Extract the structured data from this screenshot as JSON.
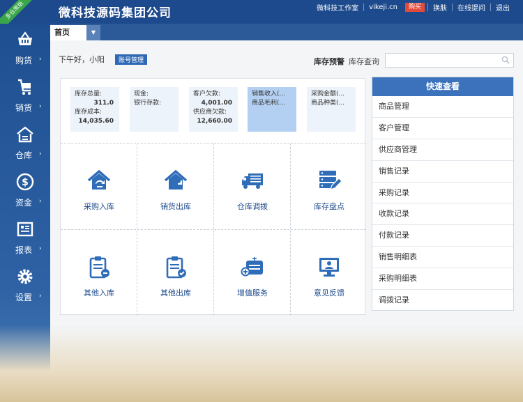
{
  "header": {
    "ribbon": "多仓库版",
    "company": "微科技源码集团公司",
    "links": [
      "微科技工作室",
      "vikeji.cn",
      "购买",
      "换肤",
      "在线提问",
      "退出"
    ]
  },
  "sidebar": {
    "items": [
      {
        "label": "购货",
        "icon": "basket-icon"
      },
      {
        "label": "销货",
        "icon": "cart-icon"
      },
      {
        "label": "仓库",
        "icon": "warehouse-icon"
      },
      {
        "label": "资金",
        "icon": "dollar-icon"
      },
      {
        "label": "报表",
        "icon": "report-icon"
      },
      {
        "label": "设置",
        "icon": "gear-icon"
      }
    ],
    "arrow": "›"
  },
  "tabs": {
    "home": "首页",
    "dropdown": "▼"
  },
  "top": {
    "greeting": "下午好，小阳",
    "account_btn": "账号管理",
    "stock_warn": "库存预警",
    "stock_query": "库存查询",
    "search_placeholder": ""
  },
  "stats": [
    {
      "lines": [
        {
          "k": "库存总量:",
          "v": "311.0"
        },
        {
          "k": "库存成本:",
          "v": "14,035.60"
        }
      ]
    },
    {
      "lines": [
        {
          "k": "现金:",
          "v": ""
        },
        {
          "k": "银行存款:",
          "v": ""
        }
      ]
    },
    {
      "lines": [
        {
          "k": "客户欠款:",
          "v": "4,001.00"
        },
        {
          "k": "供应商欠款:",
          "v": "12,660.00"
        }
      ]
    },
    {
      "lines": [
        {
          "k": "销售收入(...",
          "v": ""
        },
        {
          "k": "商品毛利(...",
          "v": ""
        }
      ]
    },
    {
      "lines": [
        {
          "k": "采购金额(...",
          "v": ""
        },
        {
          "k": "商品种类(...",
          "v": ""
        }
      ]
    }
  ],
  "actions": [
    {
      "label": "采购入库",
      "icon": "purchase-in-icon"
    },
    {
      "label": "销货出库",
      "icon": "sales-out-icon"
    },
    {
      "label": "仓库调拨",
      "icon": "truck-transfer-icon"
    },
    {
      "label": "库存盘点",
      "icon": "inventory-check-icon"
    },
    {
      "label": "其他入库",
      "icon": "clipboard-in-icon"
    },
    {
      "label": "其他出库",
      "icon": "clipboard-out-icon"
    },
    {
      "label": "增值服务",
      "icon": "value-service-icon"
    },
    {
      "label": "意见反馈",
      "icon": "feedback-icon"
    }
  ],
  "quick": {
    "title": "快速查看",
    "items": [
      "商品管理",
      "客户管理",
      "供应商管理",
      "销售记录",
      "采购记录",
      "收款记录",
      "付款记录",
      "销售明细表",
      "采购明细表",
      "调拨记录"
    ]
  },
  "colors": {
    "primary": "#1d4a8c",
    "accent": "#3c72bc",
    "buy": "#e04b3c"
  }
}
